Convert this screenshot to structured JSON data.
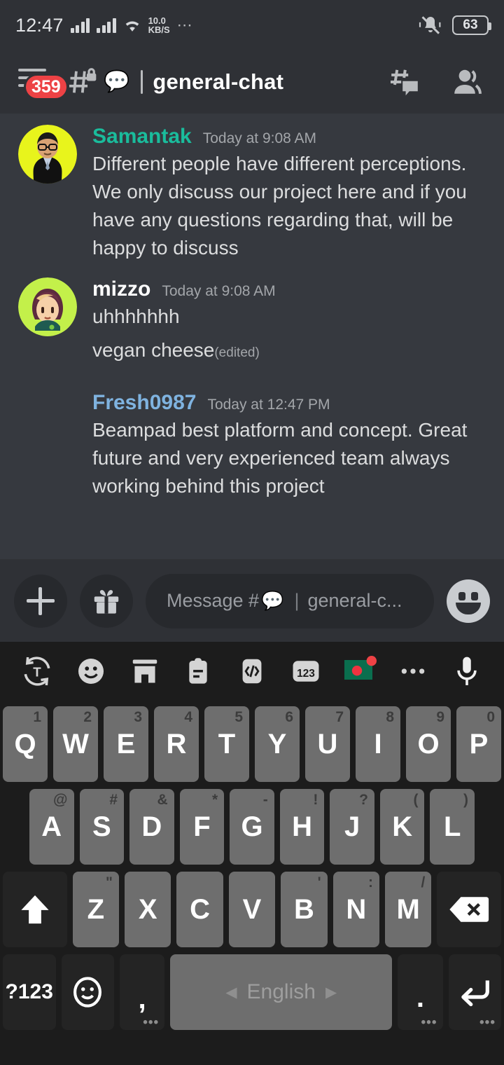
{
  "status_bar": {
    "time": "12:47",
    "network_speed_value": "10.0",
    "network_speed_unit": "KB/S",
    "overflow_dots": "⋯",
    "battery_level": "63",
    "icons": [
      "signal-bars-sim1",
      "signal-bars-sim2",
      "wifi-icon",
      "silent-mode-icon",
      "battery-icon"
    ]
  },
  "header": {
    "unread_badge": "359",
    "channel_lock_icon": "hash-lock-icon",
    "channel_emoji": "💬",
    "title": "general-chat",
    "right_icons": [
      "threads-icon",
      "members-icon"
    ]
  },
  "messages": [
    {
      "author": "Samantak",
      "author_color": "#1abc9c",
      "timestamp": "Today at 9:08 AM",
      "avatar": "samantak-avatar",
      "lines": [
        "Different people have different perceptions. We only discuss our project here and if you have any questions regarding that, will be happy to discuss"
      ],
      "edited": ""
    },
    {
      "author": "mizzo",
      "author_color": "#ffffff",
      "timestamp": "Today at 9:08 AM",
      "avatar": "mizzo-avatar",
      "lines": [
        "uhhhhhhh",
        "vegan cheese"
      ],
      "edited": "(edited)"
    },
    {
      "author": "Fresh0987",
      "author_color": "#7fb3e0",
      "timestamp": "Today at 12:47 PM",
      "avatar": "",
      "lines": [
        "Beampad best platform and concept. Great future and very experienced team always working behind this project"
      ],
      "edited": ""
    }
  ],
  "composer": {
    "add_label": "+",
    "gift_icon": "gift-icon",
    "placeholder_prefix": "Message #",
    "placeholder_emoji": "💬",
    "placeholder_divider": "|",
    "placeholder_channel": "general-c...",
    "emoji_button_icon": "emoji-smile-icon"
  },
  "keyboard": {
    "toolbar": [
      {
        "name": "translate-icon",
        "label": "T"
      },
      {
        "name": "emoji-icon",
        "label": ""
      },
      {
        "name": "sticker-store-icon",
        "label": ""
      },
      {
        "name": "clipboard-icon",
        "label": ""
      },
      {
        "name": "code-translate-icon",
        "label": ""
      },
      {
        "name": "numbers-icon",
        "label": "123"
      },
      {
        "name": "language-flag-icon",
        "label": ""
      },
      {
        "name": "more-icon",
        "label": "•••"
      },
      {
        "name": "microphone-icon",
        "label": ""
      }
    ],
    "row1": [
      {
        "key": "Q",
        "hint": "1"
      },
      {
        "key": "W",
        "hint": "2"
      },
      {
        "key": "E",
        "hint": "3"
      },
      {
        "key": "R",
        "hint": "4"
      },
      {
        "key": "T",
        "hint": "5"
      },
      {
        "key": "Y",
        "hint": "6"
      },
      {
        "key": "U",
        "hint": "7"
      },
      {
        "key": "I",
        "hint": "8"
      },
      {
        "key": "O",
        "hint": "9"
      },
      {
        "key": "P",
        "hint": "0"
      }
    ],
    "row2": [
      {
        "key": "A",
        "hint": "@"
      },
      {
        "key": "S",
        "hint": "#"
      },
      {
        "key": "D",
        "hint": "&"
      },
      {
        "key": "F",
        "hint": "*"
      },
      {
        "key": "G",
        "hint": "-"
      },
      {
        "key": "H",
        "hint": "!"
      },
      {
        "key": "J",
        "hint": "?"
      },
      {
        "key": "K",
        "hint": "("
      },
      {
        "key": "L",
        "hint": ")"
      }
    ],
    "row3": [
      {
        "key": "Z",
        "hint": "\""
      },
      {
        "key": "X",
        "hint": ""
      },
      {
        "key": "C",
        "hint": ""
      },
      {
        "key": "V",
        "hint": ""
      },
      {
        "key": "B",
        "hint": "'"
      },
      {
        "key": "N",
        "hint": ":"
      },
      {
        "key": "M",
        "hint": "/"
      }
    ],
    "shift_icon": "shift-icon",
    "backspace_icon": "backspace-icon",
    "row4": {
      "symbols_label": "?123",
      "emoji_icon": "emoji-key-icon",
      "comma_label": ",",
      "space_label": "English",
      "space_left_arrow": "◀",
      "space_right_arrow": "▶",
      "period_label": ".",
      "enter_icon": "enter-icon",
      "long_press_dots": "•••"
    }
  },
  "colors": {
    "app_bg": "#36393f",
    "header_bg": "#2f3136",
    "accent_red": "#ed4245",
    "teal": "#1abc9c",
    "blue": "#7fb3e0",
    "keyboard_bg": "#1c1c1c",
    "key_bg": "#6e6e6e"
  }
}
